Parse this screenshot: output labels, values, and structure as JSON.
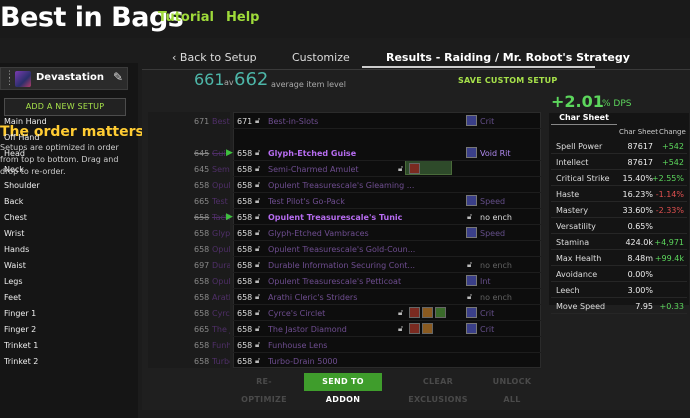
{
  "header": {
    "logo": "Best in Bags",
    "nav": [
      "Tutorial",
      "Help"
    ]
  },
  "sidebar": {
    "setup_name": "Devastation",
    "add_setup_label": "ADD A NEW SETUP",
    "order_title": "The order matters",
    "order_desc": "Setups are optimized in order from top to bottom. Drag and drop to re-order."
  },
  "tabs": {
    "back": "Back to Setup",
    "customize": "Customize",
    "results": "Results - Raiding / Mr. Robot's Strategy"
  },
  "summary": {
    "ilvl_current": "661",
    "ilvl_current_suffix": "av",
    "ilvl_best": "662",
    "ilvl_best_label": "average item level",
    "save_custom": "SAVE CUSTOM SETUP",
    "dps_change": "+2.01",
    "dps_unit": "% DPS"
  },
  "slots": [
    {
      "slot": "Main Hand",
      "cur_ilvl": "671",
      "cur_name": "Best-",
      "new_ilvl": "671",
      "new_name": "Best-in-Slots",
      "highlight": false,
      "gems": [],
      "ench_icon": true,
      "ench": "Crit",
      "ench_class": "",
      "changed": false
    },
    {
      "slot": "Off Hand",
      "cur_ilvl": "",
      "cur_name": "",
      "new_ilvl": "",
      "new_name": "",
      "highlight": false,
      "gems": [],
      "ench_icon": false,
      "ench": "",
      "ench_class": "",
      "changed": false
    },
    {
      "slot": "Head",
      "cur_ilvl": "645",
      "cur_name": "Gui",
      "new_ilvl": "658",
      "new_name": "Glyph-Etched Guise",
      "highlight": true,
      "gems": [],
      "ench_icon": true,
      "ench": "Void Rit",
      "ench_class": "hl",
      "changed": true
    },
    {
      "slot": "Neck",
      "cur_ilvl": "645",
      "cur_name": "Semi",
      "new_ilvl": "658",
      "new_name": "Semi-Charmed Amulet",
      "highlight": false,
      "gems": [
        "r"
      ],
      "ench_icon": false,
      "ench": "",
      "ench_class": "",
      "changed": false
    },
    {
      "slot": "Shoulder",
      "cur_ilvl": "658",
      "cur_name": "Opule",
      "new_ilvl": "658",
      "new_name": "Opulent Treasurescale's Gleaming ...",
      "highlight": false,
      "gems": [],
      "ench_icon": false,
      "ench": "",
      "ench_class": "",
      "changed": false
    },
    {
      "slot": "Back",
      "cur_ilvl": "665",
      "cur_name": "Test F",
      "new_ilvl": "658",
      "new_name": "Test Pilot's Go-Pack",
      "highlight": false,
      "gems": [],
      "ench_icon": true,
      "ench": "Speed",
      "ench_class": "",
      "changed": false
    },
    {
      "slot": "Chest",
      "cur_ilvl": "658",
      "cur_name": "Tacti",
      "new_ilvl": "658",
      "new_name": "Opulent Treasurescale's Tunic",
      "highlight": true,
      "gems": [],
      "ench_icon": false,
      "ench": "no ench",
      "ench_class": "none",
      "changed": true
    },
    {
      "slot": "Wrist",
      "cur_ilvl": "658",
      "cur_name": "Glyph",
      "new_ilvl": "658",
      "new_name": "Glyph-Etched Vambraces",
      "highlight": false,
      "gems": [],
      "ench_icon": true,
      "ench": "Speed",
      "ench_class": "",
      "changed": false
    },
    {
      "slot": "Hands",
      "cur_ilvl": "658",
      "cur_name": "Opule",
      "new_ilvl": "658",
      "new_name": "Opulent Treasurescale's Gold-Coun...",
      "highlight": false,
      "gems": [],
      "ench_icon": false,
      "ench": "",
      "ench_class": "",
      "changed": false
    },
    {
      "slot": "Waist",
      "cur_ilvl": "697",
      "cur_name": "Durab",
      "new_ilvl": "658",
      "new_name": "Durable Information Securing Cont...",
      "highlight": false,
      "gems": [],
      "ench_icon": false,
      "ench": "no ench",
      "ench_class": "dim",
      "changed": false
    },
    {
      "slot": "Legs",
      "cur_ilvl": "658",
      "cur_name": "Opule",
      "new_ilvl": "658",
      "new_name": "Opulent Treasurescale's Petticoat",
      "highlight": false,
      "gems": [],
      "ench_icon": true,
      "ench": "Int",
      "ench_class": "",
      "changed": false
    },
    {
      "slot": "Feet",
      "cur_ilvl": "658",
      "cur_name": "Arath",
      "new_ilvl": "658",
      "new_name": "Arathi Cleric's Striders",
      "highlight": false,
      "gems": [],
      "ench_icon": false,
      "ench": "no ench",
      "ench_class": "dim",
      "changed": false
    },
    {
      "slot": "Finger 1",
      "cur_ilvl": "658",
      "cur_name": "Cyrce",
      "new_ilvl": "658",
      "new_name": "Cyrce's Circlet",
      "highlight": false,
      "gems": [
        "r",
        "o",
        "g"
      ],
      "ench_icon": true,
      "ench": "Crit",
      "ench_class": "",
      "changed": false
    },
    {
      "slot": "Finger 2",
      "cur_ilvl": "665",
      "cur_name": "The Ja",
      "new_ilvl": "658",
      "new_name": "The Jastor Diamond",
      "highlight": false,
      "gems": [
        "r",
        "o"
      ],
      "ench_icon": true,
      "ench": "Crit",
      "ench_class": "",
      "changed": false
    },
    {
      "slot": "Trinket 1",
      "cur_ilvl": "658",
      "cur_name": "Funho",
      "new_ilvl": "658",
      "new_name": "Funhouse Lens",
      "highlight": false,
      "gems": [],
      "ench_icon": false,
      "ench": "",
      "ench_class": "",
      "changed": false
    },
    {
      "slot": "Trinket 2",
      "cur_ilvl": "658",
      "cur_name": "Turbo",
      "new_ilvl": "658",
      "new_name": "Turbo-Drain 5000",
      "highlight": false,
      "gems": [],
      "ench_icon": false,
      "ench": "",
      "ench_class": "",
      "changed": false
    }
  ],
  "buttons": {
    "reoptimize": "RE-OPTIMIZE",
    "send": "SEND TO ADDON",
    "clear": "CLEAR EXCLUSIONS",
    "unlock": "UNLOCK ALL"
  },
  "charsheet": {
    "title": "Char Sheet",
    "head_value": "Char Sheet",
    "head_change": "Change",
    "rows": [
      {
        "stat": "Spell Power",
        "value": "87617",
        "change": "+542",
        "cls": "pos"
      },
      {
        "stat": "Intellect",
        "value": "87617",
        "change": "+542",
        "cls": "pos"
      },
      {
        "stat": "Critical Strike",
        "value": "15.40%",
        "change": "+2.55%",
        "cls": "pos"
      },
      {
        "stat": "Haste",
        "value": "16.23%",
        "change": "-1.14%",
        "cls": "neg"
      },
      {
        "stat": "Mastery",
        "value": "33.60%",
        "change": "-2.33%",
        "cls": "neg"
      },
      {
        "stat": "Versatility",
        "value": "0.65%",
        "change": "",
        "cls": "neu"
      },
      {
        "stat": "Stamina",
        "value": "424.0k",
        "change": "+4,971",
        "cls": "pos"
      },
      {
        "stat": "Max Health",
        "value": "8.48m",
        "change": "+99.4k",
        "cls": "pos"
      },
      {
        "stat": "Avoidance",
        "value": "0.00%",
        "change": "",
        "cls": "neu"
      },
      {
        "stat": "Leech",
        "value": "3.00%",
        "change": "",
        "cls": "neu"
      },
      {
        "stat": "Move Speed",
        "value": "7.95",
        "change": "+0.33",
        "cls": "pos"
      }
    ]
  },
  "colors": {
    "accent_green": "#9fdb3a",
    "teal": "#4db6a8",
    "epic_purple": "#a335ee",
    "positive": "#5cd65c",
    "negative": "#e05050"
  }
}
